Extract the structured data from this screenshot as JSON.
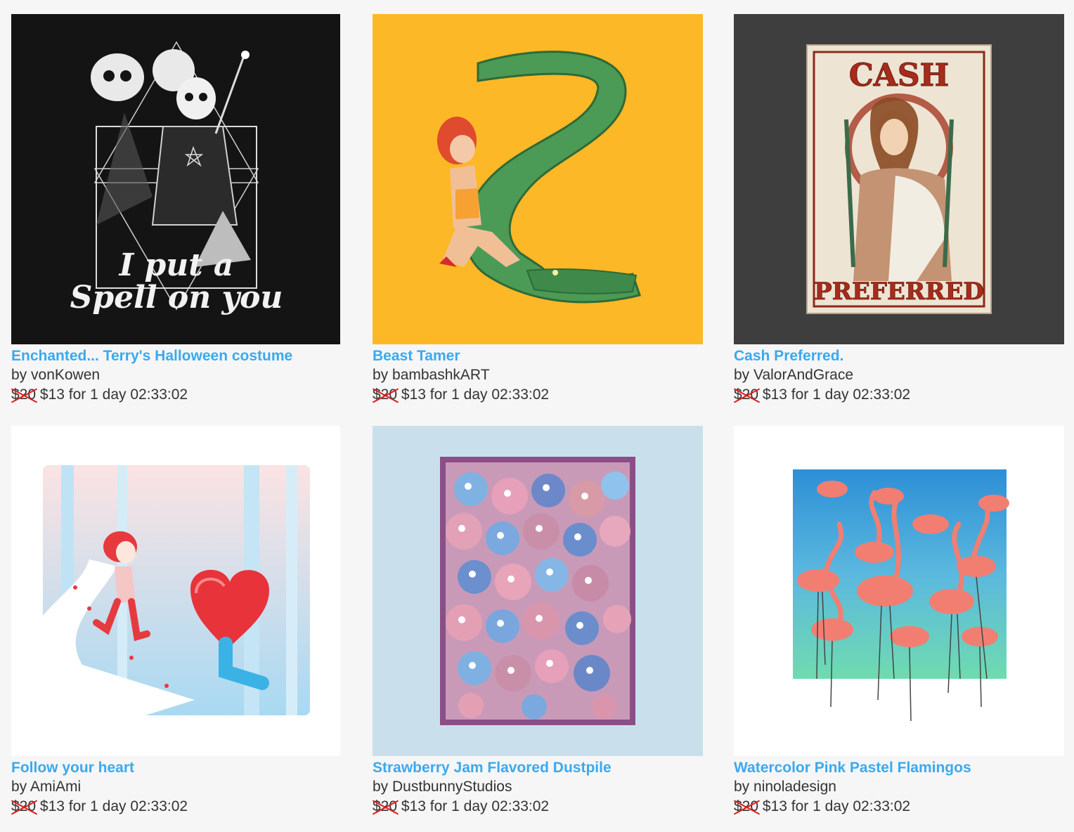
{
  "currency_timer": "for 1 day 02:33:02",
  "products": [
    {
      "title": "Enchanted... Terry's Halloween costume",
      "artist": "by vonKowen",
      "old_price": "$20",
      "new_price": "$13",
      "timer": "for 1 day 02:33:02",
      "bg": "#141414",
      "artwork_text_1": "I put a",
      "artwork_text_2": "Spell on you"
    },
    {
      "title": "Beast Tamer",
      "artist": "by bambashkART",
      "old_price": "$20",
      "new_price": "$13",
      "timer": "for 1 day 02:33:02",
      "bg": "#fdb827"
    },
    {
      "title": "Cash Preferred.",
      "artist": "by ValorAndGrace",
      "old_price": "$20",
      "new_price": "$13",
      "timer": "for 1 day 02:33:02",
      "bg": "#3e3e3e",
      "artwork_text_1": "CASH",
      "artwork_text_2": "PREFERRED"
    },
    {
      "title": "Follow your heart",
      "artist": "by AmiAmi",
      "old_price": "$20",
      "new_price": "$13",
      "timer": "for 1 day 02:33:02",
      "bg": "#ffffff"
    },
    {
      "title": "Strawberry Jam Flavored Dustpile",
      "artist": "by DustbunnyStudios",
      "old_price": "$20",
      "new_price": "$13",
      "timer": "for 1 day 02:33:02",
      "bg": "#c9e0ec"
    },
    {
      "title": "Watercolor Pink Pastel Flamingos",
      "artist": "by ninoladesign",
      "old_price": "$20",
      "new_price": "$13",
      "timer": "for 1 day 02:33:02",
      "bg": "#ffffff"
    }
  ]
}
